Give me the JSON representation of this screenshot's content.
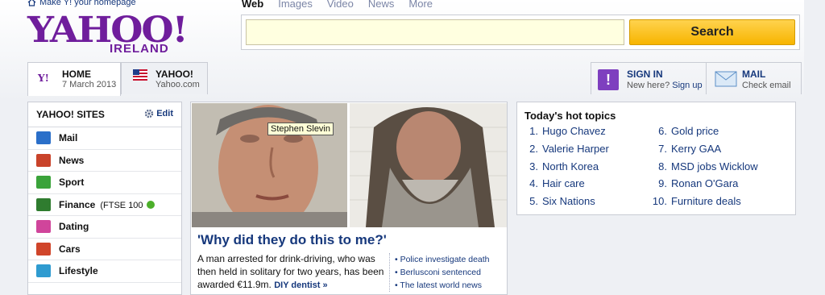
{
  "header": {
    "homepage_link": "Make Y! your homepage",
    "logo_text": "YAHOO!",
    "logo_region": "IRELAND"
  },
  "search": {
    "tabs": [
      "Web",
      "Images",
      "Video",
      "News",
      "More"
    ],
    "button_label": "Search",
    "value": ""
  },
  "nav_tabs": {
    "home": {
      "title": "HOME",
      "date": "7 March 2013",
      "badge": "Y!"
    },
    "yahoo": {
      "title": "YAHOO!",
      "sub": "Yahoo.com"
    }
  },
  "account": {
    "sign_in": "SIGN IN",
    "new_here": "New here?",
    "sign_up": "Sign up",
    "mail_title": "MAIL",
    "mail_sub": "Check email"
  },
  "sidebar": {
    "title": "YAHOO! SITES",
    "edit": "Edit",
    "items": [
      {
        "label": "Mail",
        "extra": "",
        "color": "#2a6fc9"
      },
      {
        "label": "News",
        "extra": "",
        "color": "#c9432a"
      },
      {
        "label": "Sport",
        "extra": "",
        "color": "#3aa33a"
      },
      {
        "label": "Finance",
        "extra": "(FTSE 100",
        "color": "#2f7c2f"
      },
      {
        "label": "Dating",
        "extra": "",
        "color": "#d0459b"
      },
      {
        "label": "Cars",
        "extra": "",
        "color": "#d0452a"
      },
      {
        "label": "Lifestyle",
        "extra": "",
        "color": "#2f9bd0"
      }
    ]
  },
  "story": {
    "tooltip": "Stephen Slevin",
    "headline": "'Why did they do this to me?'",
    "summary": "A man arrested for drink-driving, who was then held in solitary for two years, has been awarded €11.9m.",
    "summary_link": "DIY dentist »",
    "related": [
      "Police investigate death",
      "Berlusconi sentenced",
      "The latest world news"
    ]
  },
  "topics": {
    "title": "Today's hot topics",
    "left": [
      {
        "n": "1.",
        "t": "Hugo Chavez"
      },
      {
        "n": "2.",
        "t": "Valerie Harper"
      },
      {
        "n": "3.",
        "t": "North Korea"
      },
      {
        "n": "4.",
        "t": "Hair care"
      },
      {
        "n": "5.",
        "t": "Six Nations"
      }
    ],
    "right": [
      {
        "n": "6.",
        "t": "Gold price"
      },
      {
        "n": "7.",
        "t": "Kerry GAA"
      },
      {
        "n": "8.",
        "t": "MSD jobs Wicklow"
      },
      {
        "n": "9.",
        "t": "Ronan O'Gara"
      },
      {
        "n": "10.",
        "t": "Furniture deals"
      }
    ]
  },
  "colors": {
    "brand": "#6f1d9c",
    "link": "#16387c",
    "search_button": "#f7b500"
  }
}
